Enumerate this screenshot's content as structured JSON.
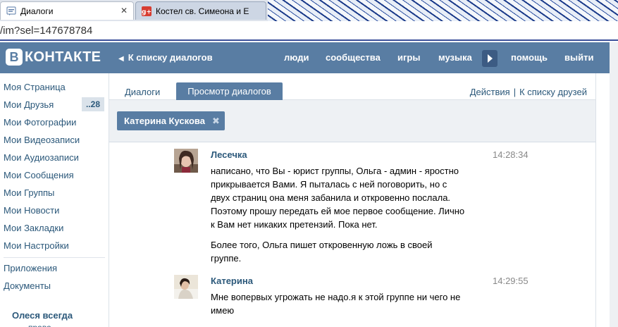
{
  "browser": {
    "tabs": [
      {
        "title": "Диалоги",
        "close": "✕"
      },
      {
        "title": "Костел св. Симеона и Е"
      }
    ],
    "address": "/im?sel=147678784"
  },
  "header": {
    "logo_letter": "В",
    "logo_text": "КОНТАКТЕ",
    "back_label": "К списку диалогов",
    "nav": [
      "люди",
      "сообщества",
      "игры",
      "музыка",
      "помощь",
      "выйти"
    ]
  },
  "sidebar": {
    "items": [
      "Моя Страница",
      "Мои Друзья",
      "Мои Фотографии",
      "Мои Видеозаписи",
      "Мои Аудиозаписи",
      "Мои Сообщения",
      "Мои Группы",
      "Мои Новости",
      "Мои Закладки",
      "Мои Настройки",
      "Приложения",
      "Документы"
    ],
    "friends_badge": "..28",
    "promo": "Олеся всегда",
    "promo_next": "права"
  },
  "content": {
    "tabs": [
      "Диалоги",
      "Просмотр диалогов"
    ],
    "actions": [
      "Действия",
      "|",
      "К списку друзей"
    ],
    "filter_chip": "Катерина Кускова",
    "chip_close": "✖",
    "messages": [
      {
        "author": "Лесечка",
        "time": "14:28:34",
        "lines": [
          "написано, что Вы - юрист группы, Ольга - админ - яростно",
          "прикрывается Вами. Я пыталась с ней поговорить, но с",
          "двух страниц она меня забанила и откровенно послала.",
          "Поэтому прошу передать ей мое первое сообщение. Лично",
          "к Вам нет никаких претензий. Пока нет."
        ],
        "lines2": [
          "Более того, Ольга пишет откровенную ложь в своей",
          "группе."
        ]
      },
      {
        "author": "Катерина",
        "time": "14:29:55",
        "lines": [
          "Мне вопервых угрожать не надо.я к этой группе ни чего не",
          "имею"
        ]
      }
    ]
  },
  "colors": {
    "brand": "#597da3",
    "link": "#2b587a"
  }
}
